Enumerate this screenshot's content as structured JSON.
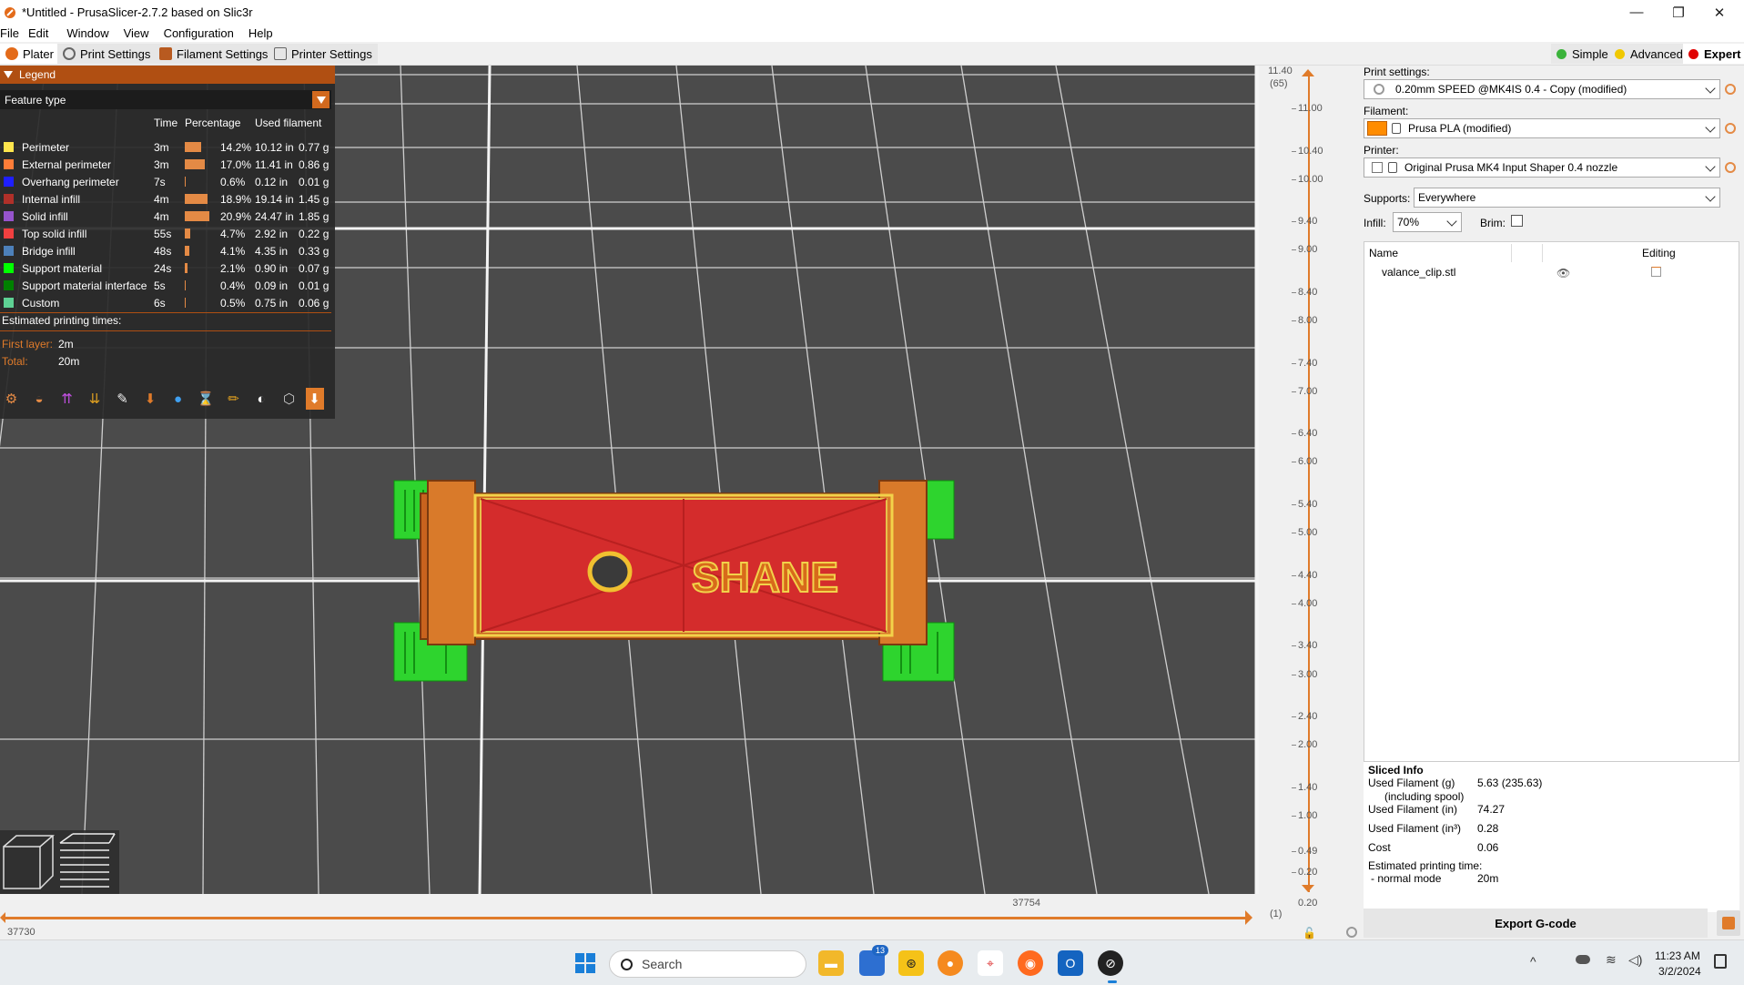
{
  "window": {
    "title": "*Untitled - PrusaSlicer-2.7.2 based on Slic3r",
    "controls": [
      "—",
      "❐",
      "✕"
    ]
  },
  "menu": [
    "File",
    "Edit",
    "Window",
    "View",
    "Configuration",
    "Help"
  ],
  "tabs": [
    "Plater",
    "Print Settings",
    "Filament Settings",
    "Printer Settings"
  ],
  "modes": [
    {
      "label": "Simple",
      "color": "#3bb33b"
    },
    {
      "label": "Advanced",
      "color": "#f0c800"
    },
    {
      "label": "Expert",
      "color": "#e00000"
    }
  ],
  "legend": {
    "title": "Legend",
    "view_type": "Feature type",
    "columns": {
      "time": "Time",
      "percentage": "Percentage",
      "used_filament": "Used filament"
    },
    "rows": [
      {
        "name": "Perimeter",
        "color": "#ffe64d",
        "time": "3m",
        "pct": 14.2,
        "pct_label": "14.2%",
        "inches": "10.12 in",
        "grams": "0.77 g"
      },
      {
        "name": "External perimeter",
        "color": "#ff7d38",
        "time": "3m",
        "pct": 17.0,
        "pct_label": "17.0%",
        "inches": "11.41 in",
        "grams": "0.86 g"
      },
      {
        "name": "Overhang perimeter",
        "color": "#1f1fff",
        "time": "7s",
        "pct": 0.6,
        "pct_label": "0.6%",
        "inches": "0.12 in",
        "grams": "0.01 g"
      },
      {
        "name": "Internal infill",
        "color": "#b03029",
        "time": "4m",
        "pct": 18.9,
        "pct_label": "18.9%",
        "inches": "19.14 in",
        "grams": "1.45 g"
      },
      {
        "name": "Solid infill",
        "color": "#9654cc",
        "time": "4m",
        "pct": 20.9,
        "pct_label": "20.9%",
        "inches": "24.47 in",
        "grams": "1.85 g"
      },
      {
        "name": "Top solid infill",
        "color": "#f04040",
        "time": "55s",
        "pct": 4.7,
        "pct_label": "4.7%",
        "inches": "2.92 in",
        "grams": "0.22 g"
      },
      {
        "name": "Bridge infill",
        "color": "#4d80ba",
        "time": "48s",
        "pct": 4.1,
        "pct_label": "4.1%",
        "inches": "4.35 in",
        "grams": "0.33 g"
      },
      {
        "name": "Support material",
        "color": "#00ff00",
        "time": "24s",
        "pct": 2.1,
        "pct_label": "2.1%",
        "inches": "0.90 in",
        "grams": "0.07 g"
      },
      {
        "name": "Support material interface",
        "color": "#008000",
        "time": "5s",
        "pct": 0.4,
        "pct_label": "0.4%",
        "inches": "0.09 in",
        "grams": "0.01 g"
      },
      {
        "name": "Custom",
        "color": "#5ed194",
        "time": "6s",
        "pct": 0.5,
        "pct_label": "0.5%",
        "inches": "0.75 in",
        "grams": "0.06 g"
      }
    ],
    "estimated_title": "Estimated printing times:",
    "first_layer_label": "First layer:",
    "first_layer_value": "2m",
    "total_label": "Total:",
    "total_value": "20m"
  },
  "model_text": "SHANE",
  "hslider": {
    "left_value": "37730",
    "right_value": "37754"
  },
  "vslider": {
    "top_value": "11.40",
    "top_layer": "(65)",
    "bottom_value": "0.20",
    "bottom_layer": "(1)",
    "ticks": [
      "11.40",
      "11.00",
      "10.40",
      "10.00",
      "9.40",
      "9.00",
      "8.40",
      "8.00",
      "7.40",
      "7.00",
      "6.40",
      "6.00",
      "5.40",
      "5.00",
      "4.40",
      "4.00",
      "3.40",
      "3.00",
      "2.40",
      "2.00",
      "1.40",
      "1.00",
      "0.49",
      "0.20"
    ]
  },
  "right_panel": {
    "print_settings_label": "Print settings:",
    "print_settings_value": "0.20mm SPEED @MK4IS 0.4 - Copy (modified)",
    "filament_label": "Filament:",
    "filament_value": "Prusa PLA (modified)",
    "filament_color": "#ff8c00",
    "printer_label": "Printer:",
    "printer_value": "Original Prusa MK4 Input Shaper 0.4 nozzle",
    "supports_label": "Supports:",
    "supports_value": "Everywhere",
    "infill_label": "Infill:",
    "infill_value": "70%",
    "brim_label": "Brim:",
    "list_name_header": "Name",
    "list_editing_header": "Editing",
    "object_name": "valance_clip.stl"
  },
  "sliced_info": {
    "title": "Sliced Info",
    "rows": [
      {
        "label": "Used Filament (g)",
        "label2": "(including spool)",
        "value": "5.63 (235.63)"
      },
      {
        "label": "Used Filament (in)",
        "value": "74.27"
      },
      {
        "label": "Used Filament (in³)",
        "value": "0.28"
      },
      {
        "label": "Cost",
        "value": "0.06"
      },
      {
        "label": "Estimated printing time:",
        "label2": "- normal mode",
        "value": "20m"
      }
    ],
    "export_label": "Export G-code"
  },
  "taskbar": {
    "search_placeholder": "Search",
    "badge": "13",
    "time": "11:23 AM",
    "date": "3/2/2024",
    "chevron": "^"
  }
}
